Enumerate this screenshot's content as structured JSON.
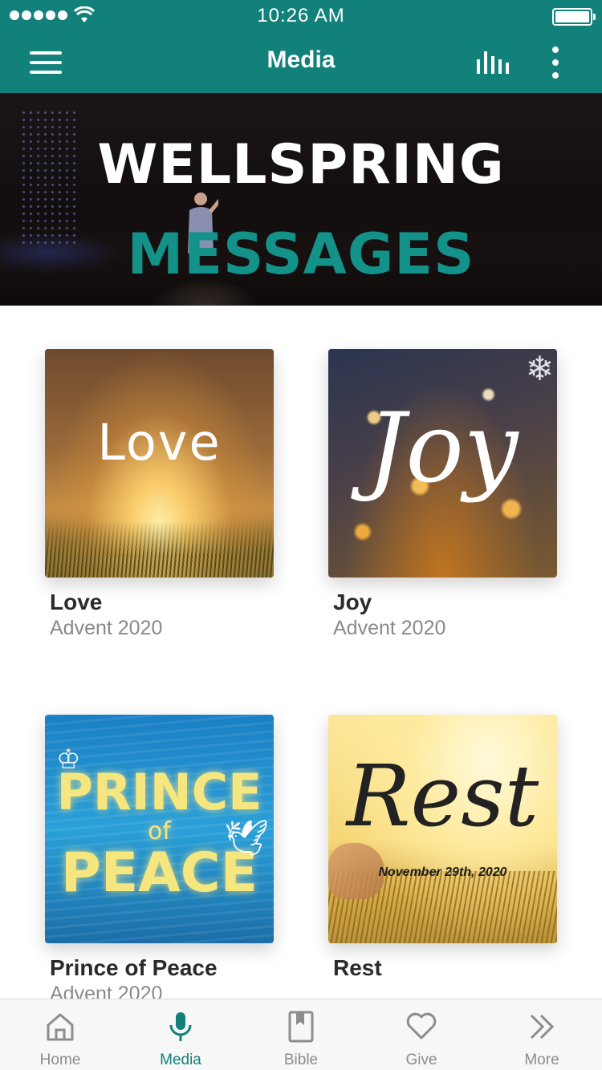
{
  "status_bar": {
    "time": "10:26 AM"
  },
  "nav": {
    "title": "Media"
  },
  "banner": {
    "line1": "WELLSPRING",
    "line2": "MESSAGES"
  },
  "media": {
    "items": [
      {
        "title": "Love",
        "subtitle": "Advent 2020",
        "art_text": "Love"
      },
      {
        "title": "Joy",
        "subtitle": "Advent 2020",
        "art_text": "Joy"
      },
      {
        "title": "Prince of Peace",
        "subtitle": "Advent 2020",
        "art_line1": "PRINCE",
        "art_line2": "of",
        "art_line3": "PEACE"
      },
      {
        "title": "Rest",
        "subtitle": "",
        "art_text": "Rest",
        "art_date": "November 29th, 2020"
      }
    ]
  },
  "tabs": [
    {
      "label": "Home",
      "icon": "home-icon"
    },
    {
      "label": "Media",
      "icon": "microphone-icon",
      "active": true
    },
    {
      "label": "Bible",
      "icon": "bible-icon"
    },
    {
      "label": "Give",
      "icon": "heart-icon"
    },
    {
      "label": "More",
      "icon": "chevrons-right-icon"
    }
  ],
  "colors": {
    "brand": "#11817a",
    "inactive_tab": "#8c8c8c",
    "banner_accent": "#13928a"
  }
}
